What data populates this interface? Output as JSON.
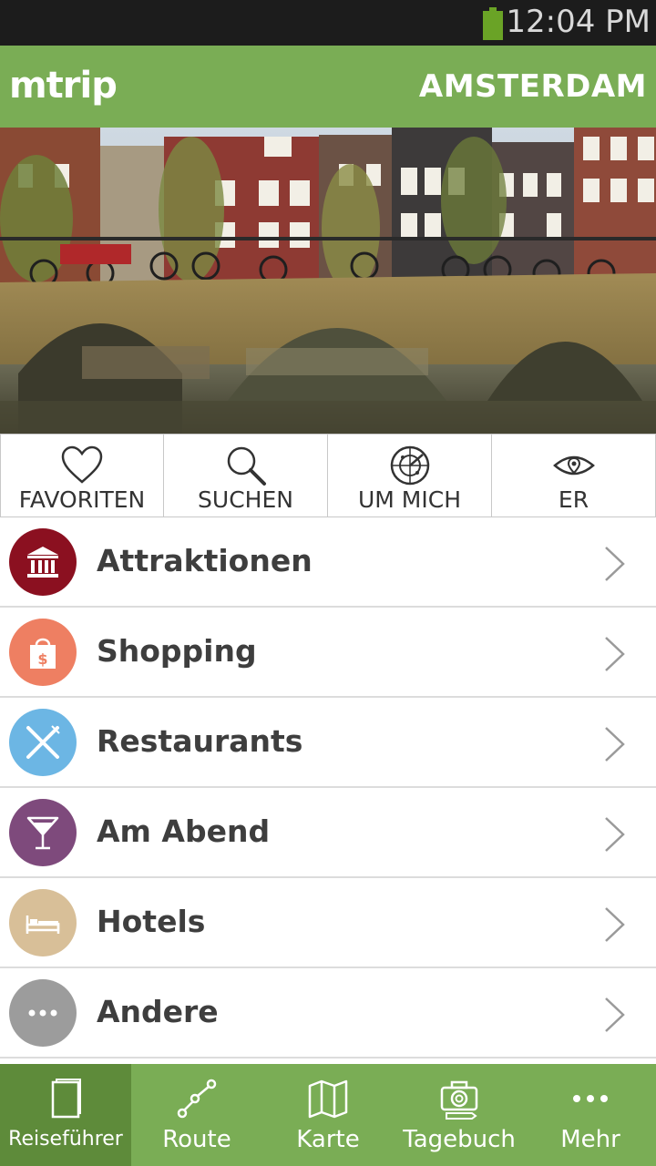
{
  "status_bar": {
    "time": "12:04 PM",
    "battery_color": "#6aa326"
  },
  "header": {
    "logo": "mtrip",
    "city": "AMSTERDAM",
    "bg_color": "#7aad55"
  },
  "hero": {
    "description_icon": "photo"
  },
  "quick_actions": [
    {
      "label": "FAVORITEN",
      "icon": "heart-icon"
    },
    {
      "label": "SUCHEN",
      "icon": "search-icon"
    },
    {
      "label": "UM MICH",
      "icon": "radar-icon"
    },
    {
      "label": "ER",
      "icon": "eye-icon"
    }
  ],
  "categories": [
    {
      "label": "Attraktionen",
      "icon": "museum-icon",
      "color": "#8b1020"
    },
    {
      "label": "Shopping",
      "icon": "shopping-bag-icon",
      "color": "#ee7f62"
    },
    {
      "label": "Restaurants",
      "icon": "cutlery-icon",
      "color": "#6cb6e4"
    },
    {
      "label": "Am Abend",
      "icon": "cocktail-icon",
      "color": "#7e4a7c"
    },
    {
      "label": "Hotels",
      "icon": "bed-icon",
      "color": "#d8bf98"
    },
    {
      "label": "Andere",
      "icon": "more-icon",
      "color": "#9c9c9c"
    }
  ],
  "bottom_nav": [
    {
      "label": "Reiseführer",
      "icon": "guidebook-icon",
      "active": true
    },
    {
      "label": "Route",
      "icon": "route-icon",
      "active": false
    },
    {
      "label": "Karte",
      "icon": "map-icon",
      "active": false
    },
    {
      "label": "Tagebuch",
      "icon": "camera-icon",
      "active": false
    },
    {
      "label": "Mehr",
      "icon": "more-dots-icon",
      "active": false
    }
  ]
}
